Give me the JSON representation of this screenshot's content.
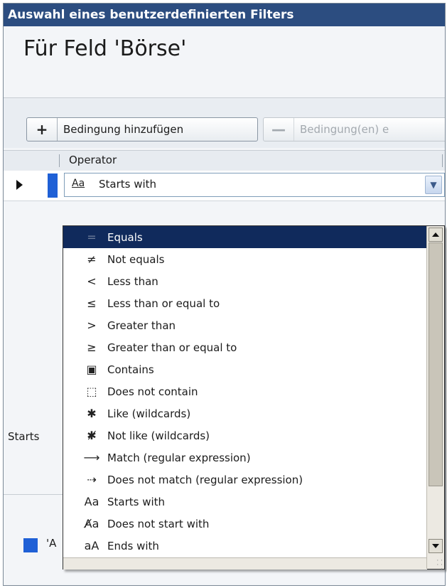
{
  "window": {
    "title": "Auswahl eines benutzerdefinierten Filters"
  },
  "header": {
    "field_title": "Für Feld 'Börse'"
  },
  "toolbar": {
    "add": {
      "symbol": "+",
      "label": "Bedingung hinzufügen"
    },
    "remove": {
      "symbol": "—",
      "label": "Bedingung(en) e"
    }
  },
  "grid": {
    "column_header": "Operator",
    "row": {
      "icon": "Aa",
      "value": "Starts with"
    }
  },
  "background_text": {
    "starts": "Starts",
    "quote_a": "'A"
  },
  "operators": [
    {
      "icon": "=",
      "icon_name": "equals-icon",
      "label": "Equals",
      "selected": true
    },
    {
      "icon": "≠",
      "icon_name": "not-equals-icon",
      "label": "Not equals"
    },
    {
      "icon": "<",
      "icon_name": "less-than-icon",
      "label": "Less than"
    },
    {
      "icon": "≤",
      "icon_name": "less-equal-icon",
      "label": "Less than or equal to"
    },
    {
      "icon": ">",
      "icon_name": "greater-than-icon",
      "label": "Greater than"
    },
    {
      "icon": "≥",
      "icon_name": "greater-equal-icon",
      "label": "Greater than or equal to"
    },
    {
      "icon": "▣",
      "icon_name": "contains-icon",
      "label": "Contains"
    },
    {
      "icon": "⬚",
      "icon_name": "not-contains-icon",
      "label": "Does not contain"
    },
    {
      "icon": "✱",
      "icon_name": "like-icon",
      "label": "Like (wildcards)"
    },
    {
      "icon": "✱̸",
      "icon_name": "not-like-icon",
      "label": "Not like (wildcards)"
    },
    {
      "icon": "⟶",
      "icon_name": "match-icon",
      "label": "Match (regular expression)"
    },
    {
      "icon": "⇢",
      "icon_name": "not-match-icon",
      "label": "Does not match (regular expression)"
    },
    {
      "icon": "Aa",
      "icon_name": "starts-with-icon",
      "label": "Starts with"
    },
    {
      "icon": "A̸a",
      "icon_name": "not-starts-with-icon",
      "label": "Does not start with"
    },
    {
      "icon": "aA",
      "icon_name": "ends-with-icon",
      "label": "Ends with"
    }
  ],
  "colors": {
    "title_bar": "#2c4d80",
    "selection": "#102a5c",
    "accent": "#1f60d6"
  }
}
